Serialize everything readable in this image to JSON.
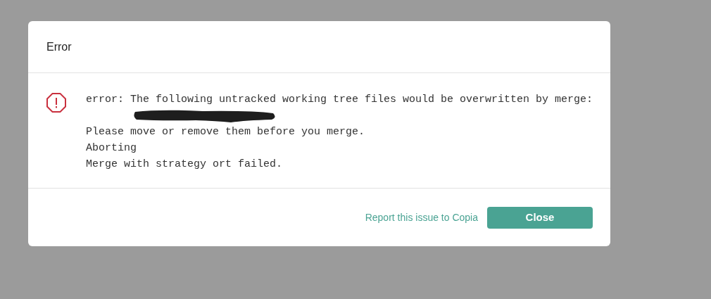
{
  "dialog": {
    "title": "Error",
    "message_lines": [
      {
        "kind": "text",
        "text": "error: The following untracked working tree files would be overwritten by merge:"
      },
      {
        "kind": "redacted"
      },
      {
        "kind": "text",
        "text": "Please move or remove them before you merge."
      },
      {
        "kind": "text",
        "text": "Aborting"
      },
      {
        "kind": "text",
        "text": "Merge with strategy ort failed."
      }
    ],
    "link": "Report this issue to Copia",
    "button": "Close"
  }
}
